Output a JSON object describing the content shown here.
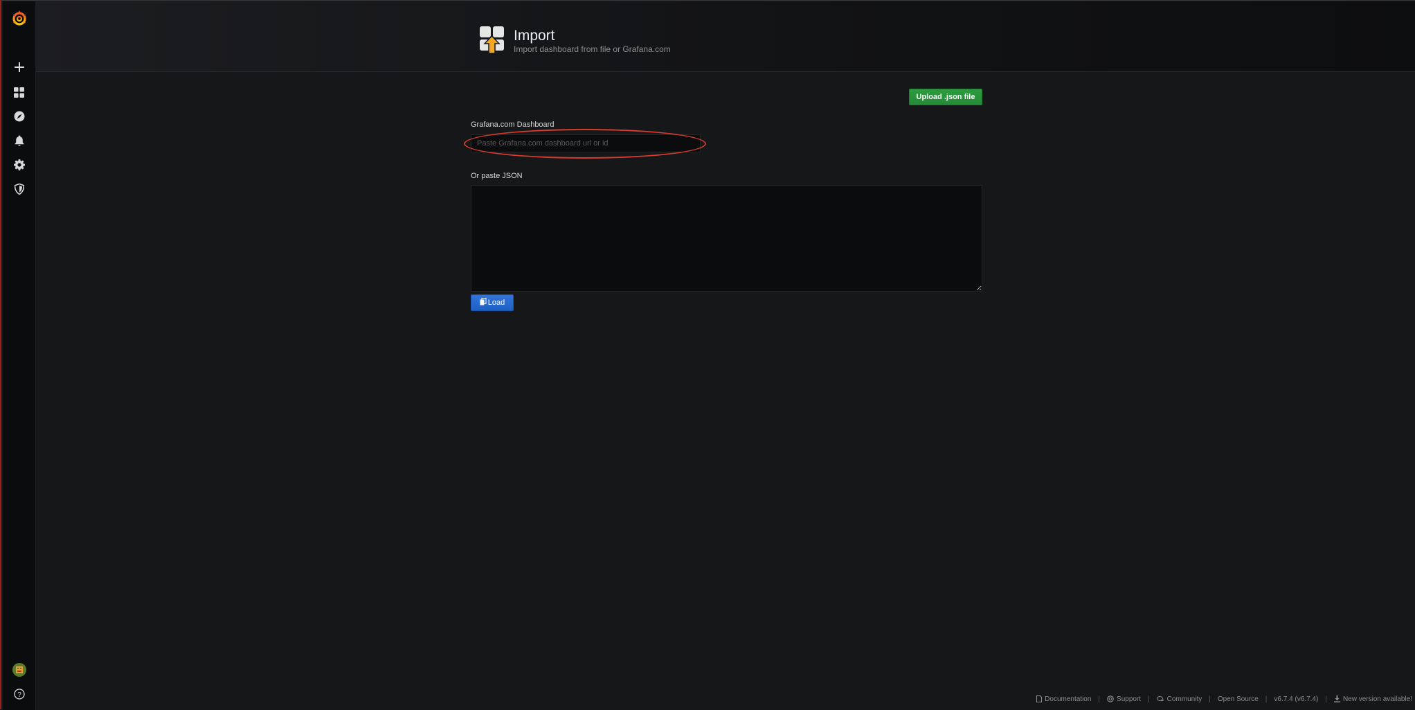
{
  "header": {
    "title": "Import",
    "subtitle": "Import dashboard from file or Grafana.com"
  },
  "sidebar": {
    "items": [
      {
        "icon": "grafana-logo-icon"
      },
      {
        "icon": "plus-icon",
        "label": "Create"
      },
      {
        "icon": "dashboards-icon",
        "label": "Dashboards"
      },
      {
        "icon": "explore-icon",
        "label": "Explore"
      },
      {
        "icon": "bell-icon",
        "label": "Alerting"
      },
      {
        "icon": "gear-icon",
        "label": "Configuration"
      },
      {
        "icon": "shield-icon",
        "label": "Server Admin"
      },
      {
        "icon": "avatar",
        "label": "Profile"
      },
      {
        "icon": "question-icon",
        "label": "Help"
      }
    ]
  },
  "main": {
    "upload_label": "Upload .json file",
    "gcom_label": "Grafana.com Dashboard",
    "gcom_placeholder": "Paste Grafana.com dashboard url or id",
    "gcom_value": "",
    "json_label": "Or paste JSON",
    "json_value": "",
    "load_label": "Load"
  },
  "footer": {
    "documentation": "Documentation",
    "support": "Support",
    "community": "Community",
    "open_source": "Open Source",
    "version": "v6.7.4 (v6.7.4)",
    "new_version": "New version available!"
  },
  "colors": {
    "background": "#161719",
    "sidebar": "#0b0c0e",
    "upload_button": "#299c46",
    "load_button": "#3274d9",
    "annotation": "#d63a2e",
    "logo_orange": "#f05a28"
  }
}
